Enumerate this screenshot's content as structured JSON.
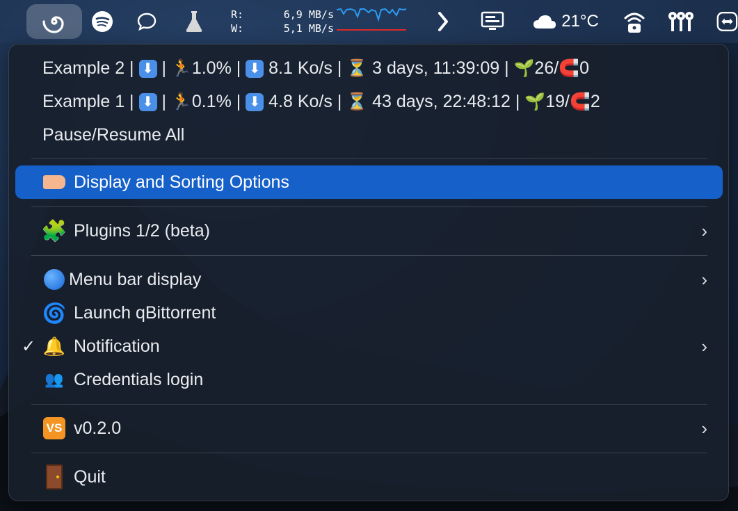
{
  "menubar": {
    "net": {
      "r_label": "R:",
      "w_label": "W:",
      "r_value": "6,9 MB/s",
      "w_value": "5,1 MB/s"
    },
    "weather": {
      "temp": "21°C"
    },
    "icons": [
      "qbittorrent-spiral-icon",
      "spotify-icon",
      "chat-bubble-icon",
      "flask-icon",
      "chevron-right-icon",
      "monitor-icon",
      "cloud-icon",
      "wifi-lock-icon",
      "keys-icon",
      "teamviewer-icon"
    ]
  },
  "menu": {
    "torrents": [
      {
        "name": "Example 2 |",
        "sep1": "|",
        "progress": "1.0% |",
        "speed": "8.1 Ko/s |",
        "eta": "3 days, 11:39:09 |",
        "seeds": "26/",
        "peers": "0"
      },
      {
        "name": "Example 1 |",
        "sep1": "|",
        "progress": "0.1% |",
        "speed": "4.8 Ko/s |",
        "eta": "43 days, 22:48:12 |",
        "seeds": "19/",
        "peers": "2"
      }
    ],
    "pause_resume": "Pause/Resume All",
    "display_sorting": "Display and Sorting Options",
    "plugins": "Plugins 1/2 (beta)",
    "menubar_display": "Menu bar display",
    "launch": "Launch qBittorrent",
    "notification": "Notification",
    "credentials": "Credentials login",
    "version": "v0.2.0",
    "quit": "Quit",
    "check_mark": "✓",
    "highlight_color": "#1660c9"
  }
}
